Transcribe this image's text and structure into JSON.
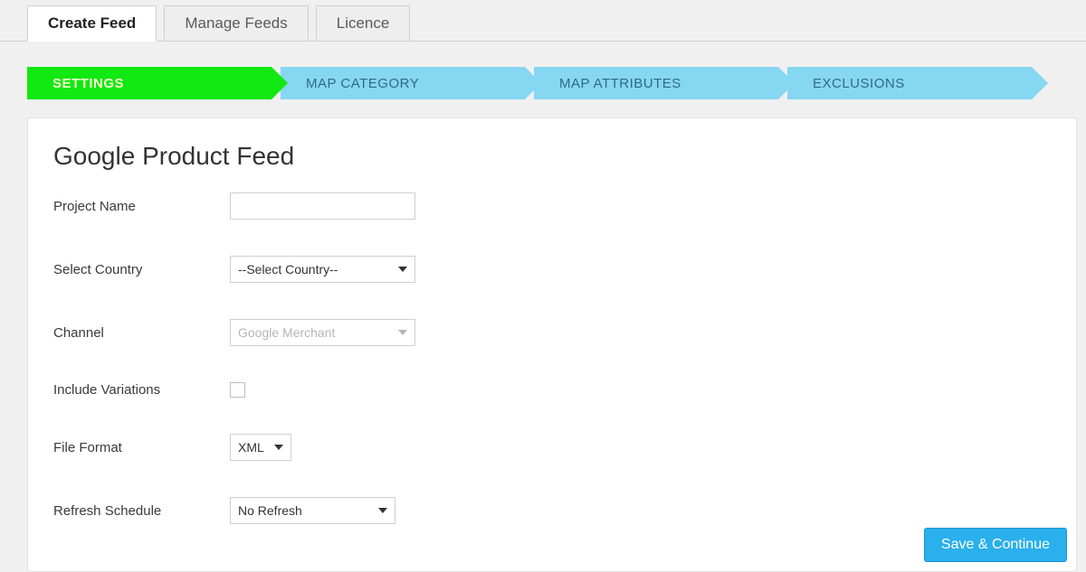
{
  "tabs": {
    "create": "Create Feed",
    "manage": "Manage Feeds",
    "licence": "Licence"
  },
  "steps": {
    "settings": "SETTINGS",
    "map_category": "MAP CATEGORY",
    "map_attributes": "MAP ATTRIBUTES",
    "exclusions": "EXCLUSIONS"
  },
  "panel": {
    "title": "Google Product Feed",
    "labels": {
      "project_name": "Project Name",
      "select_country": "Select Country",
      "channel": "Channel",
      "include_variations": "Include Variations",
      "file_format": "File Format",
      "refresh_schedule": "Refresh Schedule"
    },
    "values": {
      "project_name": "",
      "select_country": "--Select Country--",
      "channel": "Google Merchant",
      "include_variations": false,
      "file_format": "XML",
      "refresh_schedule": "No Refresh"
    },
    "save_button": "Save & Continue"
  }
}
